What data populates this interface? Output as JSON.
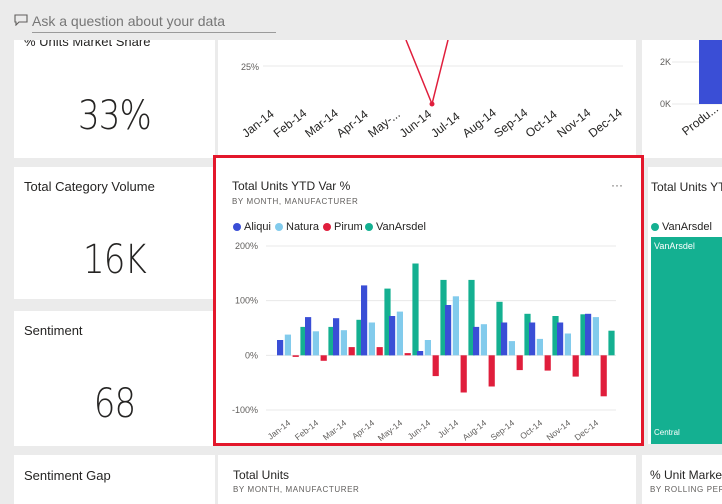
{
  "qa": {
    "placeholder": "Ask a question about your data"
  },
  "tiles": {
    "market_share": {
      "title": "% Units Market Share",
      "value": "33%"
    },
    "category_volume": {
      "title": "Total Category Volume",
      "value": "16K"
    },
    "sentiment": {
      "title": "Sentiment",
      "value": "68"
    },
    "sentiment_gap": {
      "title": "Sentiment Gap"
    },
    "total_units": {
      "title": "Total Units",
      "subtitle": "BY MONTH, MANUFACTURER"
    },
    "right_bottom": {
      "title": "% Unit Marke",
      "subtitle": "BY ROLLING PER"
    },
    "right_middle": {
      "title": "Total Units YT",
      "legend": "VanArsdel",
      "bar_label": "VanArsdel",
      "bar_bottom_label": "Central"
    },
    "right_top": {
      "tick_2k": "2K",
      "tick_0k": "0K",
      "xlabel": "Produ..."
    },
    "top_line": {
      "tick_25": "25%",
      "months": [
        "Jan-14",
        "Feb-14",
        "Mar-14",
        "Apr-14",
        "May-...",
        "Jun-14",
        "Jul-14",
        "Aug-14",
        "Sep-14",
        "Oct-14",
        "Nov-14",
        "Dec-14"
      ]
    }
  },
  "focused": {
    "title": "Total Units YTD Var %",
    "subtitle": "BY MONTH, MANUFACTURER",
    "more": "···",
    "colors": {
      "Aliqui": "#3a4ed6",
      "Natura": "#82cbec",
      "Pirum": "#e01e3c",
      "VanArsdel": "#14b091"
    }
  },
  "chart_data": {
    "type": "bar",
    "title": "Total Units YTD Var %",
    "subtitle": "BY MONTH, MANUFACTURER",
    "categories": [
      "Jan-14",
      "Feb-14",
      "Mar-14",
      "Apr-14",
      "May-14",
      "Jun-14",
      "Jul-14",
      "Aug-14",
      "Sep-14",
      "Oct-14",
      "Nov-14",
      "Dec-14"
    ],
    "series": [
      {
        "name": "Aliqui",
        "values": [
          28,
          70,
          68,
          128,
          72,
          8,
          92,
          52,
          60,
          60,
          60,
          76
        ]
      },
      {
        "name": "Natura",
        "values": [
          38,
          44,
          46,
          60,
          80,
          28,
          108,
          57,
          26,
          30,
          40,
          70
        ]
      },
      {
        "name": "Pirum",
        "values": [
          -3,
          -10,
          15,
          15,
          4,
          -38,
          -68,
          -57,
          -27,
          -28,
          -39,
          -75
        ]
      },
      {
        "name": "VanArsdel",
        "values": [
          52,
          52,
          65,
          122,
          168,
          138,
          138,
          98,
          76,
          72,
          75,
          45
        ]
      }
    ],
    "yticks": [
      "200%",
      "100%",
      "0%",
      "-100%"
    ],
    "ylim": [
      -100,
      200
    ],
    "legend_position": "top-left",
    "grid": true
  }
}
